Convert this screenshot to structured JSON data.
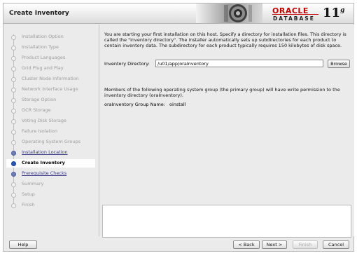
{
  "window": {
    "title": "Create Inventory"
  },
  "branding": {
    "oracle": "ORACLE",
    "database": "DATABASE",
    "version": "11",
    "version_suffix": "g"
  },
  "colors": {
    "oracle_red": "#c00000",
    "current_step": "#2a57b5",
    "link_step": "#3b3b8a",
    "disabled_step": "#9c9c9c"
  },
  "steps": [
    {
      "label": "Installation Option",
      "state": "disabled"
    },
    {
      "label": "Installation Type",
      "state": "disabled"
    },
    {
      "label": "Product Languages",
      "state": "disabled"
    },
    {
      "label": "Grid Plug and Play",
      "state": "disabled"
    },
    {
      "label": "Cluster Node Information",
      "state": "disabled"
    },
    {
      "label": "Network Interface Usage",
      "state": "disabled"
    },
    {
      "label": "Storage Option",
      "state": "disabled"
    },
    {
      "label": "OCR Storage",
      "state": "disabled"
    },
    {
      "label": "Voting Disk Storage",
      "state": "disabled"
    },
    {
      "label": "Failure Isolation",
      "state": "disabled"
    },
    {
      "label": "Operating System Groups",
      "state": "disabled"
    },
    {
      "label": "Installation Location",
      "state": "link"
    },
    {
      "label": "Create Inventory",
      "state": "current"
    },
    {
      "label": "Prerequisite Checks",
      "state": "link"
    },
    {
      "label": "Summary",
      "state": "disabled"
    },
    {
      "label": "Setup",
      "state": "disabled"
    },
    {
      "label": "Finish",
      "state": "disabled"
    }
  ],
  "content": {
    "intro": "You are starting your first installation on this host. Specify a directory for installation files. This directory is called the \"inventory directory\". The installer automatically sets up subdirectories for each product to contain inventory data. The subdirectory for each product typically requires 150 kilobytes of disk space.",
    "inventory_label": "Inventory Directory:",
    "inventory_value": "/u01/app/oraInventory",
    "browse_label": "Browse",
    "group_text": "Members of the following operating system group (the primary group) will have write permission to the inventory directory (oraInventory).",
    "group_label": "oraInventory Group Name:",
    "group_value": "oinstall"
  },
  "footer": {
    "help": "Help",
    "back": "< Back",
    "next": "Next >",
    "finish": "Finish",
    "cancel": "Cancel"
  }
}
